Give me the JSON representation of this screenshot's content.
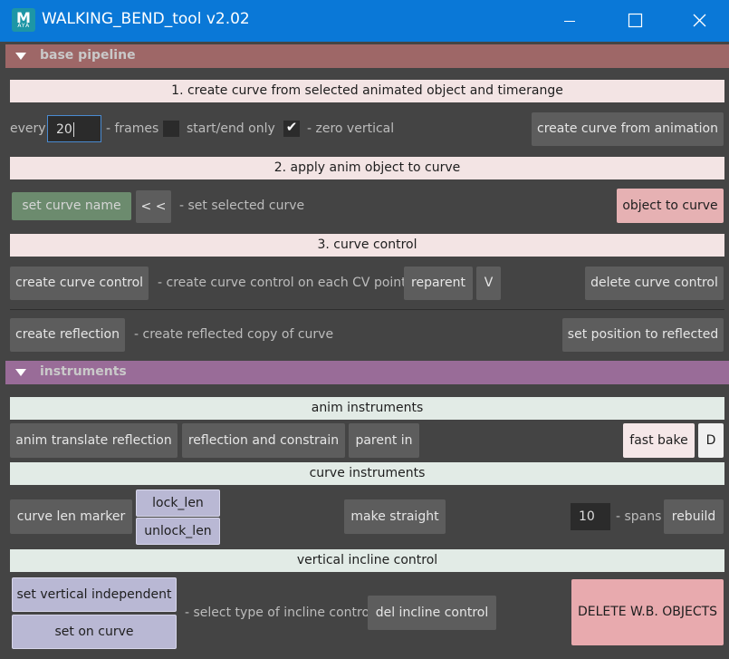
{
  "window": {
    "title": "WALKING_BEND_tool v2.02",
    "app_icon_letter": "M",
    "app_icon_sub": "ΑΥΑ",
    "minimize_icon": "minimize-icon",
    "maximize_icon": "maximize-icon",
    "close_icon": "close-icon",
    "titlebar_color": "#0a78d7"
  },
  "base_pipeline": {
    "header": "base pipeline",
    "header_color": "#9e6767",
    "step1": {
      "title": "1. create curve from selected animated object and timerange",
      "every_label": "every",
      "every_value": "20",
      "frames_label": "- frames",
      "start_end_checked": false,
      "start_end_label": "start/end only",
      "zero_vertical_checked": true,
      "zero_vertical_label": "- zero vertical",
      "create_button": "create curve from animation"
    },
    "step2": {
      "title": "2. apply anim object to curve",
      "curve_name_button": "set curve name",
      "arrow_button": "< <",
      "set_selected_label": "- set selected curve",
      "object_to_curve_button": "object to curve"
    },
    "step3": {
      "title": "3. curve control",
      "create_control_button": "create curve control",
      "create_control_desc": "- create curve control on each CV point",
      "reparent_button": "reparent",
      "v_button": "V",
      "delete_control_button": "delete curve control",
      "create_reflection_button": "create reflection",
      "reflection_desc": "- create reflected copy of curve",
      "set_position_button": "set position to reflected"
    }
  },
  "instruments": {
    "header": "instruments",
    "header_color": "#996c98",
    "anim": {
      "title": "anim instruments",
      "translate_reflection_button": "anim translate reflection",
      "reflection_constrain_button": "reflection and constrain",
      "parent_in_button": "parent in",
      "fast_bake_button": "fast bake",
      "d_button": "D"
    },
    "curve": {
      "title": "curve instruments",
      "len_marker_button": "curve len marker",
      "lock_len_button": "lock_len",
      "unlock_len_button": "unlock_len",
      "make_straight_button": "make straight",
      "spans_value": "10",
      "spans_label": "- spans",
      "rebuild_button": "rebuild"
    },
    "vertical": {
      "title": "vertical incline control",
      "independent_button": "set vertical independent",
      "on_curve_button": "set on curve",
      "select_type_label": "- select type of incline control",
      "del_incline_button": "del incline control",
      "delete_objects_button": "DELETE W.B. OBJECTS"
    }
  }
}
